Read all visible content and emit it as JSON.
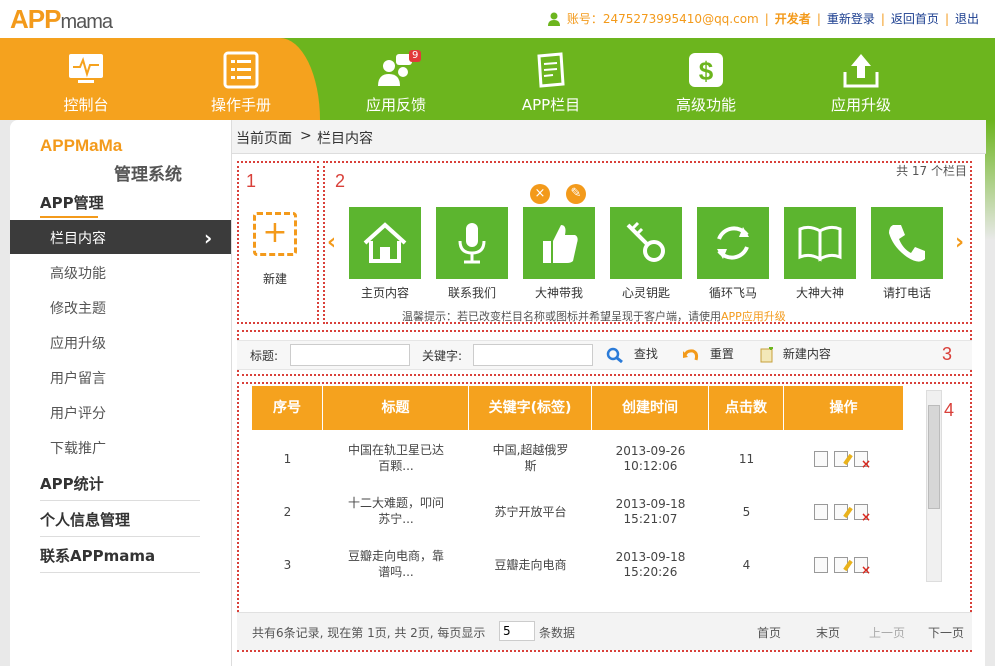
{
  "logo": {
    "brand": "APP",
    "suffix": "mama"
  },
  "topbar": {
    "account": "账号：2475273995410@qq.com",
    "developer": "开发者",
    "relogin": "重新登录",
    "home": "返回首页",
    "logout": "退出",
    "sep": "|"
  },
  "nav": {
    "items": [
      {
        "label": "控制台",
        "icon": "monitor-icon"
      },
      {
        "label": "操作手册",
        "icon": "list-icon"
      },
      {
        "label": "应用反馈",
        "icon": "users-chat-icon",
        "badge": "9"
      },
      {
        "label": "APP栏目",
        "icon": "pen-doc-icon"
      },
      {
        "label": "高级功能",
        "icon": "dollar-icon"
      },
      {
        "label": "应用升级",
        "icon": "upload-icon"
      }
    ]
  },
  "sidebar": {
    "brand_line1": "APPMaMa",
    "brand_line2": "管理系统",
    "section_app": "APP管理",
    "active_item": "栏目内容",
    "items": [
      "高级功能",
      "修改主题",
      "应用升级",
      "用户留言",
      "用户评分",
      "下载推广"
    ],
    "section_stats": "APP统计",
    "section_profile": "个人信息管理",
    "section_contact": "联系APPmama"
  },
  "breadcrumb": {
    "current": "当前页面",
    "arrow": ">",
    "page": "栏目内容"
  },
  "columns": {
    "total": "共 17 个栏目",
    "new_label": "新建",
    "tiles": [
      "主页内容",
      "联系我们",
      "大神带我",
      "心灵钥匙",
      "循环飞马",
      "大神大神",
      "请打电话"
    ],
    "tip": "温馨提示：若已改变栏目名称或图标并希望呈现于客户端，请使用",
    "tip_link": "APP应用升级"
  },
  "markers": [
    "1",
    "2",
    "3",
    "4"
  ],
  "search": {
    "title_label": "标题:",
    "title_value": "",
    "keyword_label": "关键字:",
    "keyword_value": "",
    "search_btn": "查找",
    "reset_btn": "重置",
    "new_btn": "新建内容"
  },
  "table": {
    "headers": [
      "序号",
      "标题",
      "关键字(标签)",
      "创建时间",
      "点击数",
      "操作"
    ],
    "rows": [
      {
        "no": "1",
        "title1": "中国在轨卫星已达",
        "title2": "百颗...",
        "kw1": "中国,超越俄罗",
        "kw2": "斯",
        "date": "2013-09-26",
        "time": "10:12:06",
        "clicks": "11"
      },
      {
        "no": "2",
        "title1": "十二大难题，叩问",
        "title2": "苏宁...",
        "kw1": "苏宁开放平台",
        "kw2": "",
        "date": "2013-09-18",
        "time": "15:21:07",
        "clicks": "5"
      },
      {
        "no": "3",
        "title1": "豆瓣走向电商，靠",
        "title2": "谱吗...",
        "kw1": "豆瓣走向电商",
        "kw2": "",
        "date": "2013-09-18",
        "time": "15:20:26",
        "clicks": "4"
      }
    ]
  },
  "footer": {
    "summary": "共有6条记录, 现在第 1页, 共 2页, 每页显示",
    "per_page": "5",
    "suffix": "条数据",
    "first": "首页",
    "last": "末页",
    "prev": "上一页",
    "next": "下一页"
  },
  "colors": {
    "orange": "#f5a21e",
    "green": "#6cb51e",
    "red": "#d9403a"
  }
}
